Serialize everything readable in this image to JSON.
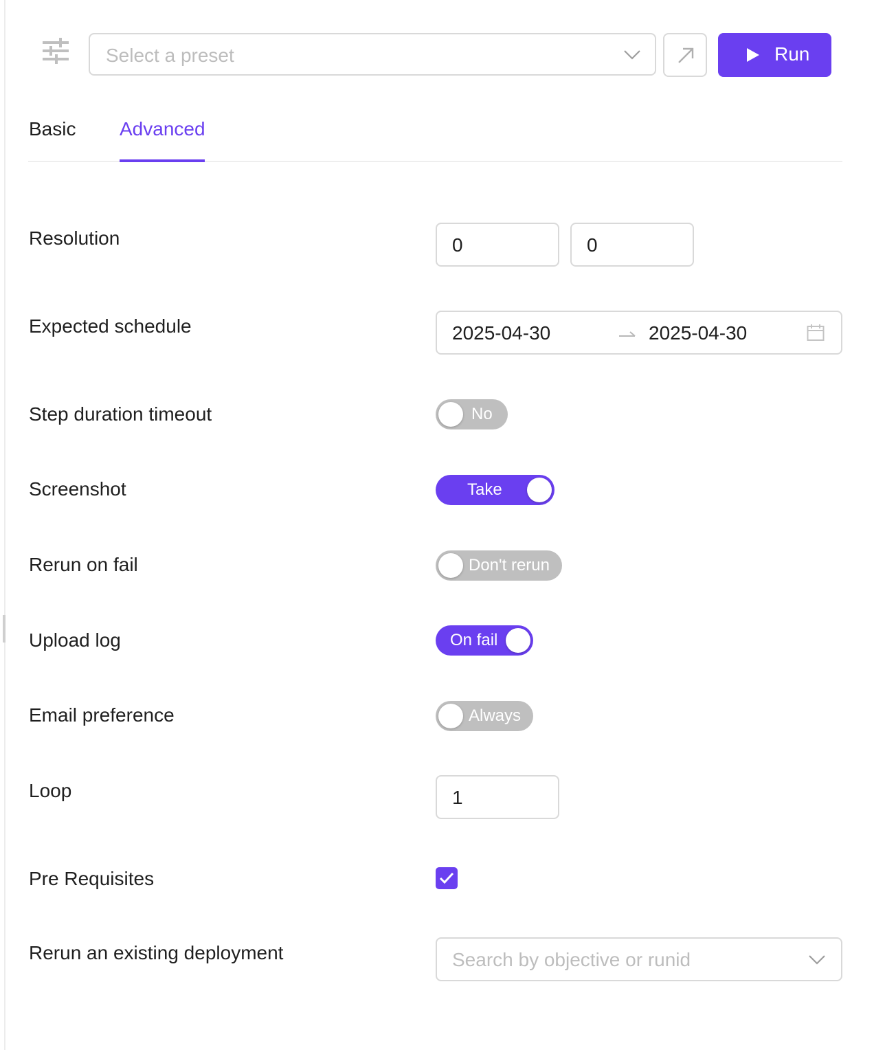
{
  "accent_color": "#6a3ff0",
  "toolbar": {
    "filter_icon": "sliders-icon",
    "preset_placeholder": "Select a preset",
    "open_icon": "arrow-up-right-icon",
    "run_label": "Run",
    "run_icon": "play-icon"
  },
  "tabs": [
    {
      "label": "Basic",
      "active": false
    },
    {
      "label": "Advanced",
      "active": true
    }
  ],
  "form": {
    "resolution": {
      "label": "Resolution",
      "width": "0",
      "height": "0"
    },
    "schedule": {
      "label": "Expected schedule",
      "start": "2025-04-30",
      "end": "2025-04-30",
      "icon": "calendar-icon"
    },
    "step_timeout": {
      "label": "Step duration timeout",
      "value": "No",
      "on": false
    },
    "screenshot": {
      "label": "Screenshot",
      "value": "Take",
      "on": true
    },
    "rerun_on_fail": {
      "label": "Rerun on fail",
      "value": "Don't rerun",
      "on": false
    },
    "upload_log": {
      "label": "Upload log",
      "value": "On fail",
      "on": true
    },
    "email_preference": {
      "label": "Email preference",
      "value": "Always",
      "on": false
    },
    "loop": {
      "label": "Loop",
      "value": "1"
    },
    "pre_requisites": {
      "label": "Pre Requisites",
      "checked": true
    },
    "rerun_deployment": {
      "label": "Rerun an existing deployment",
      "placeholder": "Search by objective or runid"
    }
  }
}
